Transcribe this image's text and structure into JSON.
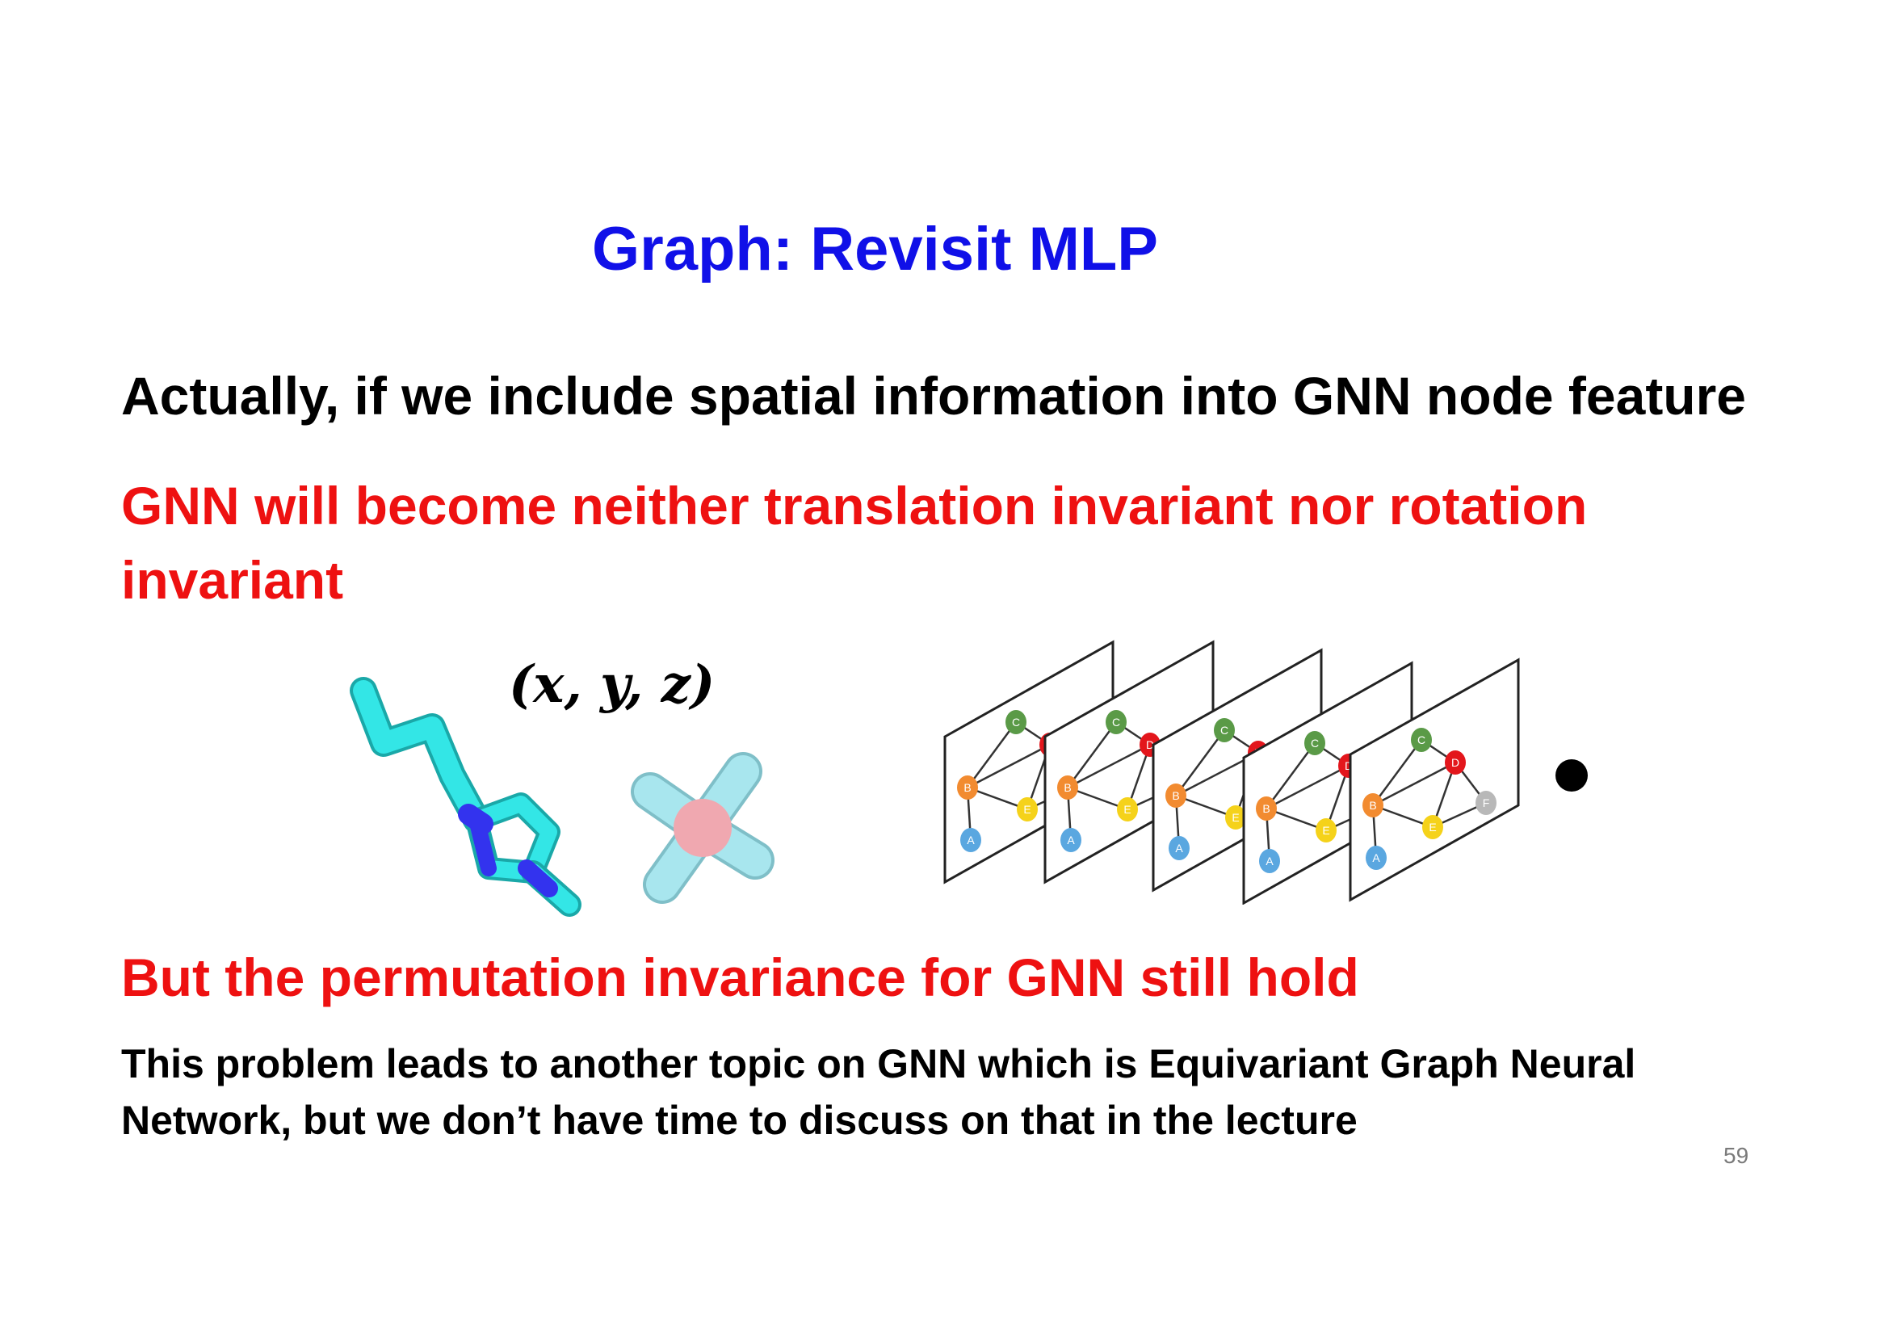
{
  "slide": {
    "title": "Graph: Revisit MLP",
    "line1": "Actually, if we include spatial information into GNN node feature",
    "line2": "GNN will become neither translation invariant nor rotation invariant",
    "coordinates": "(x, y, z)",
    "line3": "But the permutation invariance for GNN still hold",
    "note": "This problem leads to another topic on GNN which is Equivariant Graph Neural Network, but we don’t have time to discuss on that in the lecture",
    "page_number": "59"
  },
  "colors": {
    "title": "#1010e8",
    "emphasis": "#ee1111",
    "body": "#000000",
    "molecule_carbon": "#33e6e6",
    "molecule_nitrogen": "#3333ee",
    "tetra_center": "#f0a8b0",
    "tetra_arm": "#a8e6ee"
  },
  "graph_nodes": [
    "A",
    "B",
    "C",
    "D",
    "E",
    "F"
  ],
  "icons": [
    "molecule-3d-icon",
    "tetrahedral-molecule-icon",
    "graph-stack-icon",
    "bullet-dot-icon"
  ]
}
